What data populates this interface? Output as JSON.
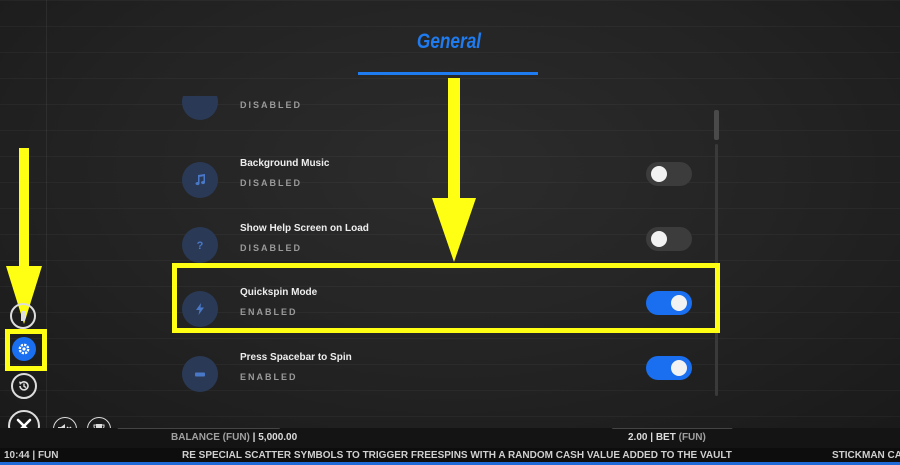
{
  "panel": {
    "title": "General"
  },
  "settings": [
    {
      "label": "",
      "status": "DISABLED",
      "enabled": false,
      "icon": "partial-icon"
    },
    {
      "label": "Background Music",
      "status": "DISABLED",
      "enabled": false,
      "icon": "music-note-icon"
    },
    {
      "label": "Show Help Screen on Load",
      "status": "DISABLED",
      "enabled": false,
      "icon": "question-mark-icon"
    },
    {
      "label": "Quickspin Mode",
      "status": "ENABLED",
      "enabled": true,
      "icon": "lightning-bolt-icon"
    },
    {
      "label": "Press Spacebar to Spin",
      "status": "ENABLED",
      "enabled": true,
      "icon": "spacebar-icon"
    }
  ],
  "bottom_bar": {
    "balance_label": "BALANCE (FUN)",
    "balance_value": "5,000.00",
    "bet_value": "2.00",
    "bet_label": "BET",
    "bet_currency": "(FUN)"
  },
  "status_bar": {
    "time": "10:44",
    "mode": "FUN",
    "ticker": "RE SPECIAL SCATTER SYMBOLS TO TRIGGER FREESPINS WITH A RANDOM CASH VALUE ADDED TO THE VAULT",
    "game_name": "STICKMAN CASH"
  },
  "colors": {
    "accent": "#1e7bf0",
    "highlight": "#ffff14",
    "toggle_on": "#1a6ff0",
    "toggle_off": "#3c3c3c"
  }
}
